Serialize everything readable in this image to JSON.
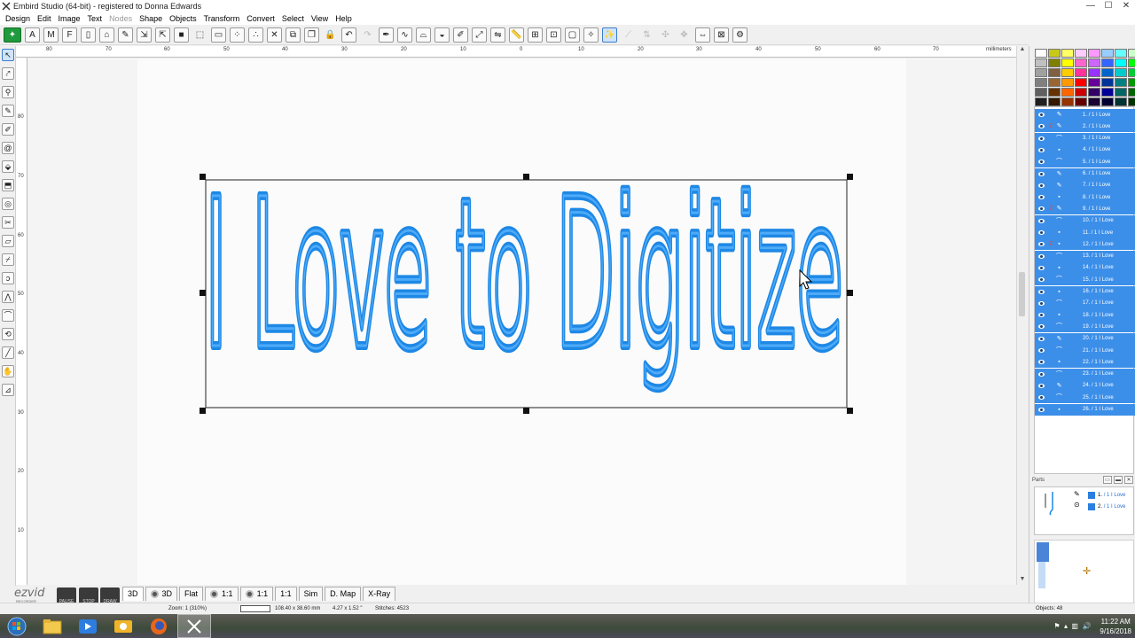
{
  "window": {
    "title": "Embird Studio (64-bit)  - registered to Donna Edwards",
    "controls": {
      "minimize": "—",
      "maximize": "☐",
      "close": "✕"
    }
  },
  "menu": [
    "Design",
    "Edit",
    "Image",
    "Text",
    "Nodes",
    "Shape",
    "Objects",
    "Transform",
    "Convert",
    "Select",
    "View",
    "Help"
  ],
  "menu_disabled": [
    "Nodes"
  ],
  "ruler": {
    "unit": "millimeters",
    "h_labels": [
      "80",
      "70",
      "60",
      "50",
      "40",
      "30",
      "20",
      "10",
      "0",
      "10",
      "20",
      "30",
      "40",
      "50",
      "60",
      "70"
    ],
    "v_labels": [
      "80",
      "70",
      "60",
      "50",
      "40",
      "30",
      "20",
      "10"
    ]
  },
  "design": {
    "text": "I Love to Digitize",
    "thread_color": "#1e88e5"
  },
  "palette": [
    "#ffffff",
    "#c8c818",
    "#ffff66",
    "#ffccff",
    "#ff99ff",
    "#99ccff",
    "#66ffff",
    "#ccffcc",
    "#c0c0c0",
    "#808000",
    "#ffff00",
    "#ff66cc",
    "#cc66ff",
    "#3366ff",
    "#00ffff",
    "#00ff00",
    "#a0a0a0",
    "#806040",
    "#ffcc00",
    "#ff3399",
    "#9933ff",
    "#0066cc",
    "#00cccc",
    "#00cc33",
    "#808080",
    "#996633",
    "#ff9900",
    "#ff0000",
    "#660099",
    "#003399",
    "#008080",
    "#009900",
    "#606060",
    "#663300",
    "#ff6600",
    "#cc0000",
    "#330066",
    "#000099",
    "#006666",
    "#006600",
    "#202020",
    "#331a00",
    "#993300",
    "#660000",
    "#1a0033",
    "#000033",
    "#003333",
    "#003300"
  ],
  "objects": [
    {
      "num": "1.",
      "label": "/ 1   I Love",
      "flag": "",
      "icon": "thread"
    },
    {
      "num": "2.",
      "label": "/ 1   I Love",
      "flag": "Z",
      "icon": "thread"
    },
    {
      "num": "3.",
      "label": "/ 1   I Love",
      "flag": "",
      "icon": "run"
    },
    {
      "num": "4.",
      "label": "/ 1   I Love",
      "flag": "",
      "icon": "dot"
    },
    {
      "num": "5.",
      "label": "/ 1   I Love",
      "flag": "",
      "icon": "run"
    },
    {
      "num": "6.",
      "label": "/ 1   I Love",
      "flag": "",
      "icon": "thread"
    },
    {
      "num": "7.",
      "label": "/ 1   I Love",
      "flag": "",
      "icon": "thread"
    },
    {
      "num": "8.",
      "label": "/ 1   I Love",
      "flag": "",
      "icon": "dot"
    },
    {
      "num": "9.",
      "label": "/ 1   I Love",
      "flag": "Z",
      "icon": "thread"
    },
    {
      "num": "10.",
      "label": "/ 1   I Love",
      "flag": "",
      "icon": "run"
    },
    {
      "num": "11.",
      "label": "/ 1   I Love",
      "flag": "",
      "icon": "dot"
    },
    {
      "num": "12.",
      "label": "/ 1   I Love",
      "flag": "Z",
      "icon": "dot"
    },
    {
      "num": "13.",
      "label": "/ 1   I Love",
      "flag": "",
      "icon": "run"
    },
    {
      "num": "14.",
      "label": "/ 1   I Love",
      "flag": "",
      "icon": "dot"
    },
    {
      "num": "15.",
      "label": "/ 1   I Love",
      "flag": "",
      "icon": "run"
    },
    {
      "num": "16.",
      "label": "/ 1   I Love",
      "flag": "",
      "icon": "dot"
    },
    {
      "num": "17.",
      "label": "/ 1   I Love",
      "flag": "",
      "icon": "run"
    },
    {
      "num": "18.",
      "label": "/ 1   I Love",
      "flag": "",
      "icon": "dot"
    },
    {
      "num": "19.",
      "label": "/ 1   I Love",
      "flag": "",
      "icon": "run"
    },
    {
      "num": "20.",
      "label": "/ 1   I Love",
      "flag": "",
      "icon": "thread"
    },
    {
      "num": "21.",
      "label": "/ 1   I Love",
      "flag": "",
      "icon": "run"
    },
    {
      "num": "22.",
      "label": "/ 1   I Love",
      "flag": "",
      "icon": "dot"
    },
    {
      "num": "23.",
      "label": "/ 1   I Love",
      "flag": "",
      "icon": "run"
    },
    {
      "num": "24.",
      "label": "/ 1   I Love",
      "flag": "",
      "icon": "thread"
    },
    {
      "num": "25.",
      "label": "/ 1   I Love",
      "flag": "",
      "icon": "run"
    },
    {
      "num": "26.",
      "label": "/ 1   I Love",
      "flag": "",
      "icon": "dot"
    }
  ],
  "parts": {
    "title": "Parts",
    "items": [
      {
        "num": "1.",
        "label": "/ 1   I Love"
      },
      {
        "num": "2.",
        "label": "/ 1   I Love"
      }
    ]
  },
  "view_tabs": [
    "3D",
    "3D",
    "Flat",
    "1:1",
    "1:1",
    "1:1",
    "Sim",
    "D. Map",
    "X-Ray"
  ],
  "recorder": {
    "logo": "ezvid",
    "sub": "RECORDER",
    "buttons": [
      "PAUSE",
      "STOP",
      "DRAW"
    ]
  },
  "status": {
    "zoom": "Zoom: 1 (310%)",
    "size_mm": "108.40 x 38.60 mm",
    "size_in": "4.27 x 1.52 \"",
    "stitches": "Stitches: 4523",
    "objects": "Objects: 48"
  },
  "taskbar": {
    "time": "11:22 AM",
    "date": "9/16/2018"
  }
}
